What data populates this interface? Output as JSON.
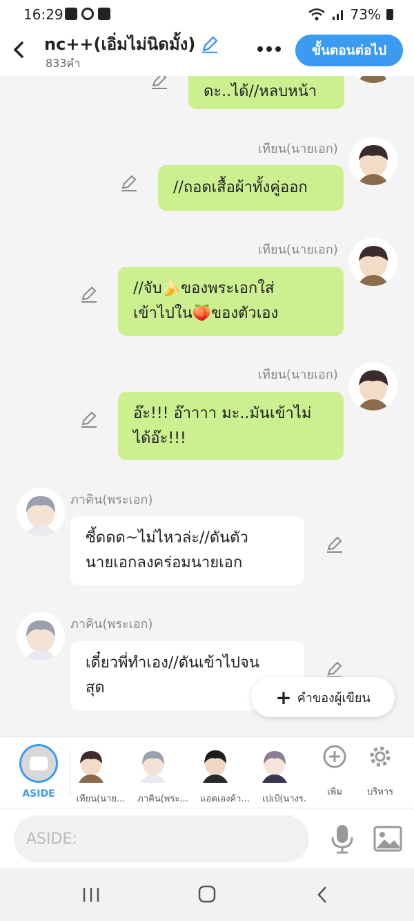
{
  "status_bar": {
    "time": "16:29",
    "battery": "73%"
  },
  "header": {
    "back_icon": "chevron-left-icon",
    "title": "nc++(เอิ่มไม่นิดมั้ง)",
    "subtitle": "833คำ",
    "more_icon": "more-dots-icon",
    "next_label": "ขั้นตอนต่อไป"
  },
  "chat": {
    "messages": [
      {
        "side": "right",
        "speaker": "",
        "text": "ดะ..ได้//หลบหน้า"
      },
      {
        "side": "right",
        "speaker": "เทียน(นายเอก)",
        "text": "//ถอดเสื้อผ้าทั้งคู่ออก"
      },
      {
        "side": "right",
        "speaker": "เทียน(นายเอก)",
        "line1": "//จับ🍌ของพระเอกใส่",
        "line2": "เข้าไปใน🍑ของตัวเอง"
      },
      {
        "side": "right",
        "speaker": "เทียน(นายเอก)",
        "line1": "อ๊ะ!!! อ๊าาาา มะ..มันเข้าไม่",
        "line2": "ได้อ๊ะ!!!"
      },
      {
        "side": "left",
        "speaker": "ภาคิน(พระเอก)",
        "line1": "ซี้ดดด~ไม่ไหวล่ะ//ดันตัว",
        "line2": "นายเอกลงคร่อมนายเอก"
      },
      {
        "side": "left",
        "speaker": "ภาคิน(พระเอก)",
        "line1": "เดี๋ยวพี่ทำเอง//ดันเข้าไปจน",
        "line2": "สุด"
      }
    ],
    "fab_label": "คำของผู้เขียน"
  },
  "character_bar": {
    "aside_label": "ASIDE",
    "characters": [
      {
        "label": "เทียน(นาย...",
        "hair": "#3a2c2a"
      },
      {
        "label": "ภาคิน(พระ...",
        "hair": "#9aa0b0"
      },
      {
        "label": "แอดเองค้า...",
        "hair": "#1e1e1e"
      },
      {
        "label": "เปเป้(นางร.",
        "hair": "#8a7d96"
      }
    ],
    "add_label": "เพิ่ม",
    "manage_label": "บริหาร"
  },
  "input_bar": {
    "placeholder": "ASIDE:"
  },
  "colors": {
    "accent": "#3b9bf0",
    "right_bubble": "#ccf090",
    "left_bubble": "#ffffff"
  }
}
